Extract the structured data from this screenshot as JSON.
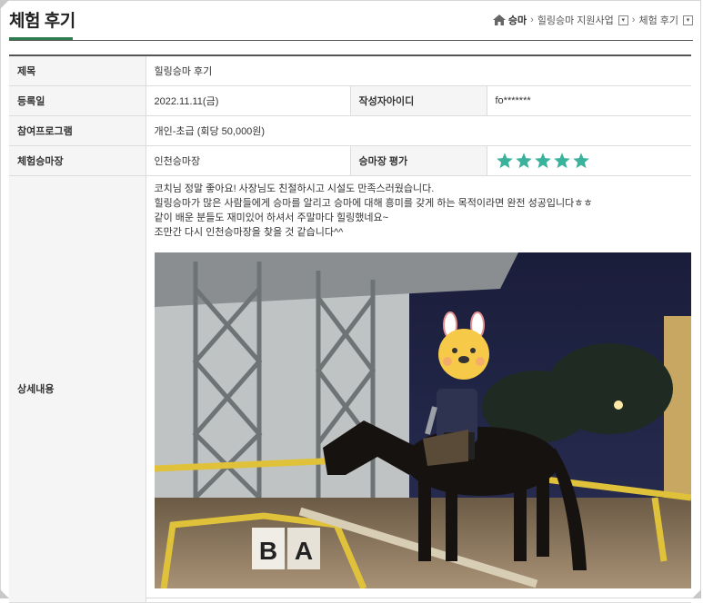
{
  "header": {
    "title": "체험 후기",
    "breadcrumb": [
      "승마",
      "힐링승마 지원사업",
      "체험 후기"
    ]
  },
  "review": {
    "labels": {
      "subject": "제목",
      "reg_date": "등록일",
      "author_id": "작성자아이디",
      "program": "참여프로그램",
      "venue": "체험승마장",
      "rating": "승마장 평가",
      "content": "상세내용"
    },
    "subject": "힐링승마 후기",
    "reg_date": "2022.11.11(금)",
    "author_id": "fo*******",
    "program": "개인-초급 (회당 50,000원)",
    "venue": "인천승마장",
    "rating": 5,
    "rating_max": 5,
    "content_lines": [
      "코치님 정말 좋아요! 사장님도 친절하시고 시설도 만족스러웠습니다.",
      "힐링승마가 많은 사람들에게 승마를 알리고 승마에 대해 흥미를 갖게 하는 목적이라면 완전 성공입니다ㅎㅎ",
      "같이 배운 분들도 재미있어 하셔서 주말마다 힐링했네요~",
      "조만간 다시 인천승마장을 찾을 것 같습니다^^"
    ],
    "photo_marker_letters": [
      "B",
      "A"
    ]
  },
  "colors": {
    "accent": "#2f7d4e",
    "star": "#3bb39c",
    "label_bg": "#f5f5f5"
  }
}
